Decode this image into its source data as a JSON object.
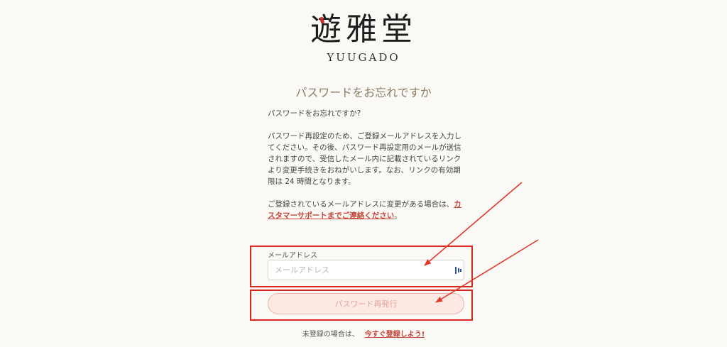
{
  "brand": {
    "logo_text": "遊雅堂",
    "logo_romaji": "YUUGADO",
    "accent_color": "#c4322e"
  },
  "page": {
    "title": "パスワードをお忘れですか"
  },
  "content": {
    "question": "パスワードをお忘れですか?",
    "instructions": "パスワード再設定のため、ご登録メールアドレスを入力してください。その後、パスワード再設定用のメールが送信されますので、受信したメール内に記載されているリンクより変更手続きをおねがいします。なお、リンクの有効期限は 24 時間となります。",
    "notice_prefix": "ご登録されているメールアドレスに変更がある場合は、",
    "notice_link": "カスタマーサポートまでご連絡ください",
    "notice_suffix": "。"
  },
  "form": {
    "email_label": "メールアドレス",
    "email_placeholder": "メールアドレス",
    "email_value": "",
    "submit_label": "パスワード再発行",
    "autofill_icon": "password-manager-icon"
  },
  "footer": {
    "prompt": "未登録の場合は、",
    "register_link": "今すぐ登録しよう!"
  },
  "annotations": {
    "highlight_color": "#d9291e",
    "arrow_color": "#e0392b"
  }
}
